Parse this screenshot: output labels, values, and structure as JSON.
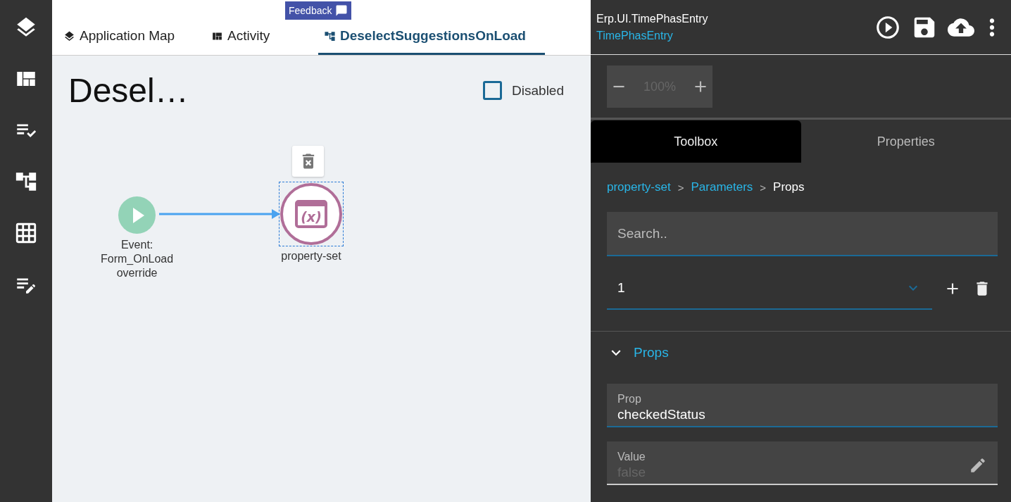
{
  "feedback": {
    "label": "Feedback"
  },
  "tabs": [
    {
      "label": "Application Map",
      "kind": "map",
      "selected": false
    },
    {
      "label": "Activity",
      "kind": "activity",
      "selected": false
    },
    {
      "label": "DeselectSuggestionsOnLoad",
      "kind": "flow",
      "selected": true
    }
  ],
  "canvas": {
    "title": "Desel…",
    "disabled_checkbox": {
      "label": "Disabled",
      "checked": false
    },
    "nodes": [
      {
        "kind": "event",
        "label_lines": [
          "Event:",
          "Form_OnLoad",
          "override"
        ],
        "selected": false
      },
      {
        "kind": "property-set",
        "icon_text": "(x)",
        "label_lines": [
          "property-set"
        ],
        "selected": true
      }
    ]
  },
  "header": {
    "title": "Erp.UI.TimePhasEntry",
    "subtitle": "TimePhasEntry"
  },
  "zoom": {
    "value": "100%"
  },
  "panel_tabs": [
    {
      "label": "Toolbox",
      "selected": true
    },
    {
      "label": "Properties",
      "selected": false
    }
  ],
  "breadcrumb": [
    {
      "label": "property-set",
      "current": false
    },
    {
      "label": "Parameters",
      "current": false
    },
    {
      "label": "Props",
      "current": true
    }
  ],
  "breadcrumb_separator": ">",
  "search": {
    "placeholder": "Search.."
  },
  "select": {
    "value": "1"
  },
  "section": {
    "title": "Props",
    "expanded": true
  },
  "fields": [
    {
      "kind": "text",
      "label": "Prop",
      "value": "checkedStatus",
      "focused": true
    },
    {
      "kind": "editable",
      "label": "Value",
      "placeholder": "false",
      "focused": false
    }
  ]
}
